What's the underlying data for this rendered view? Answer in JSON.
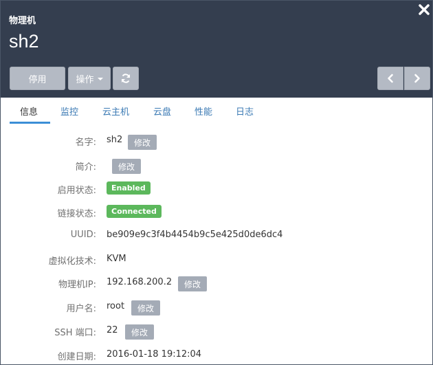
{
  "header": {
    "kind_label": "物理机",
    "title": "sh2"
  },
  "toolbar": {
    "disable_label": "停用",
    "actions_label": "操作",
    "refresh_icon": "refresh-icon",
    "prev_icon": "chevron-left-icon",
    "next_icon": "chevron-right-icon",
    "close_icon": "close-icon"
  },
  "tabs": [
    {
      "label": "信息",
      "active": true
    },
    {
      "label": "监控",
      "active": false
    },
    {
      "label": "云主机",
      "active": false
    },
    {
      "label": "云盘",
      "active": false
    },
    {
      "label": "性能",
      "active": false
    },
    {
      "label": "日志",
      "active": false
    }
  ],
  "info": {
    "name": {
      "label": "名字:",
      "value": "sh2",
      "edit": "修改"
    },
    "description": {
      "label": "简介:",
      "value": "",
      "edit": "修改"
    },
    "enable_state": {
      "label": "启用状态:",
      "value": "Enabled"
    },
    "connection_state": {
      "label": "链接状态:",
      "value": "Connected"
    },
    "uuid": {
      "label": "UUID:",
      "value": "be909e9c3f4b4454b9c5e425d0de6dc4"
    },
    "virtualization": {
      "label": "虚拟化技术:",
      "value": "KVM"
    },
    "host_ip": {
      "label": "物理机IP:",
      "value": "192.168.200.2",
      "edit": "修改"
    },
    "username": {
      "label": "用户名:",
      "value": "root",
      "edit": "修改"
    },
    "ssh_port": {
      "label": "SSH 端口:",
      "value": "22",
      "edit": "修改"
    },
    "created": {
      "label": "创建日期:",
      "value": "2016-01-18 19:12:04"
    }
  },
  "colors": {
    "header_bg": "#343e4f",
    "button_bg": "#b4bac4",
    "edit_bg": "#a4abb6",
    "status_green": "#5cb85c",
    "tab_link": "#3b7ab4",
    "tab_active_underline": "#3b8ed6"
  }
}
